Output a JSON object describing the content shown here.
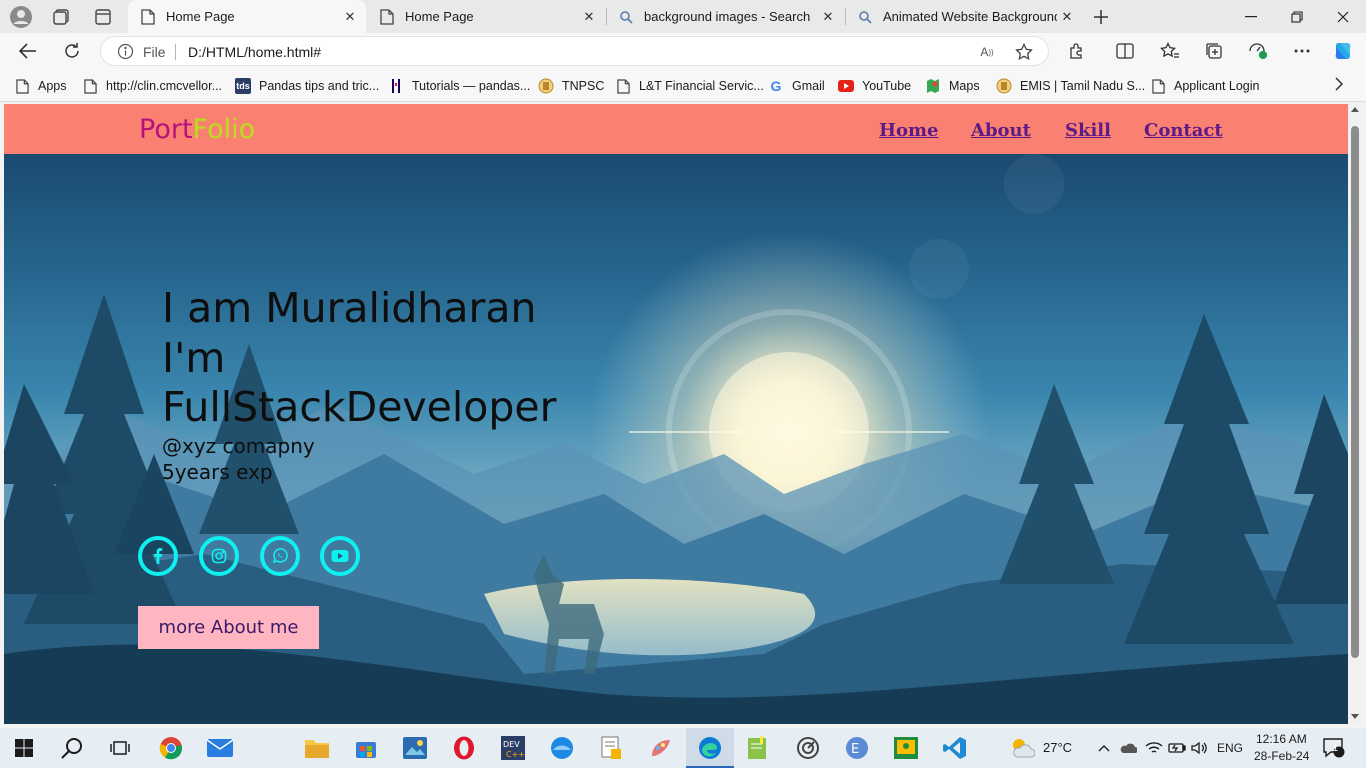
{
  "browser": {
    "tabs": [
      {
        "title": "Home Page",
        "active": true
      },
      {
        "title": "Home Page",
        "active": false
      },
      {
        "title": "background images - Search",
        "active": false
      },
      {
        "title": "Animated Website Backgrounds",
        "active": false
      }
    ],
    "address": {
      "scheme": "File",
      "url": "D:/HTML/home.html#"
    },
    "bookmarks": [
      "Apps",
      "http://clin.cmcvellor...",
      "Pandas tips and tric...",
      "Tutorials — pandas...",
      "TNPSC",
      "L&T Financial Servic...",
      "Gmail",
      "YouTube",
      "Maps",
      "EMIS | Tamil Nadu S...",
      "Applicant Login"
    ]
  },
  "site": {
    "logo_part1": "Port",
    "logo_part2": "Folio",
    "nav": [
      "Home",
      "About",
      "Skill",
      "Contact"
    ],
    "hero": {
      "name_line": "I am Muralidharan",
      "role_line1": "I'm",
      "role_line2": "FullStackDeveloper",
      "company": "@xyz comapny",
      "experience": "5years exp"
    },
    "social_icons": [
      "facebook-icon",
      "instagram-icon",
      "whatsapp-icon",
      "youtube-icon"
    ],
    "cta_label": "more About me",
    "colors": {
      "nav_bg": "#fa8072",
      "logo_port": "#b5127c",
      "logo_folio": "#b8e01a",
      "nav_link": "#5e1b86",
      "social": "#0ff0f0",
      "cta_bg": "#ffb6c1"
    }
  },
  "taskbar": {
    "weather": "27°C",
    "language": "ENG",
    "time": "12:16 AM",
    "date": "28-Feb-24",
    "notifications": "1"
  }
}
